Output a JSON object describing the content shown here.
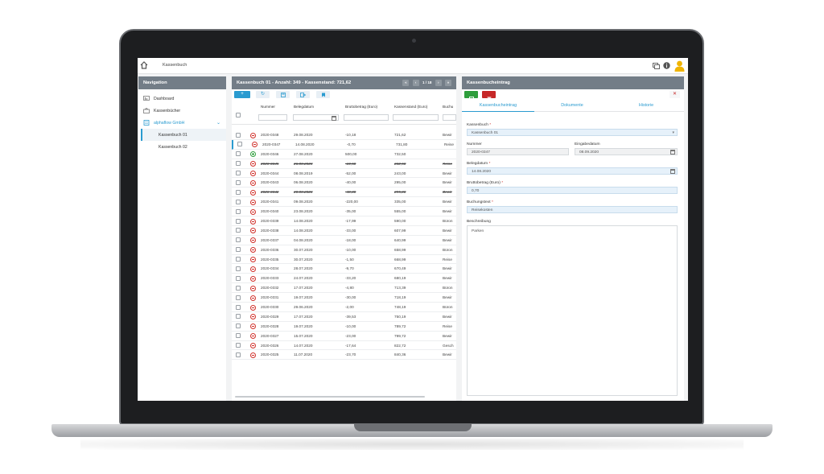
{
  "topbar": {
    "breadcrumb": "Kassenbuch"
  },
  "nav": {
    "title": "Navigation",
    "items": [
      {
        "label": "Dashboard"
      },
      {
        "label": "Kassenbücher"
      },
      {
        "label": "alphaflow GmbH"
      }
    ],
    "sub_items": [
      {
        "label": "Kassenbuch 01"
      },
      {
        "label": "Kassenbuch 02"
      }
    ]
  },
  "list": {
    "title": "Kassenbuch 01 - Anzahl: 349 - Kassenstand: 721,62",
    "pager": {
      "prev_first": "«",
      "prev": "‹",
      "page": "1 / 18",
      "next": "›",
      "next_last": "»"
    },
    "toolbar": {
      "add": "+",
      "refresh": "↻"
    },
    "columns": [
      "Nummer",
      "Belegdatum",
      "Bruttobetrag (Euro)",
      "Kassenstand (Euro)",
      "Buchu"
    ],
    "rows": [
      {
        "nummer": "2020-0348",
        "datum": "29.08.2020",
        "betrag": "-10,18",
        "stand": "721,62",
        "buchung": "Bewir",
        "status": "minus",
        "cancelled": false
      },
      {
        "nummer": "2020-0347",
        "datum": "14.08.2020",
        "betrag": "-0,70",
        "stand": "731,80",
        "buchung": "Reise",
        "status": "minus",
        "cancelled": false
      },
      {
        "nummer": "2020-0346",
        "datum": "27.08.2020",
        "betrag": "500,00",
        "stand": "732,50",
        "buchung": "",
        "status": "plus",
        "cancelled": false
      },
      {
        "nummer": "2020-0345",
        "datum": "26.08.2020",
        "betrag": "-10,50",
        "stand": "232,50",
        "buchung": "Reise",
        "status": "minus",
        "cancelled": true
      },
      {
        "nummer": "2020-0344",
        "datum": "08.08.2019",
        "betrag": "-52,00",
        "stand": "243,00",
        "buchung": "Bewir",
        "status": "minus",
        "cancelled": false
      },
      {
        "nummer": "2020-0343",
        "datum": "06.08.2020",
        "betrag": "-40,00",
        "stand": "295,00",
        "buchung": "Bewir",
        "status": "minus",
        "cancelled": false
      },
      {
        "nummer": "2020-0342",
        "datum": "20.08.2020",
        "betrag": "-40,00",
        "stand": "295,00",
        "buchung": "Bewir",
        "status": "minus",
        "cancelled": true
      },
      {
        "nummer": "2020-0341",
        "datum": "09.08.2020",
        "betrag": "-220,00",
        "stand": "335,00",
        "buchung": "Bewir",
        "status": "minus",
        "cancelled": false
      },
      {
        "nummer": "2020-0340",
        "datum": "23.08.2020",
        "betrag": "-35,00",
        "stand": "555,00",
        "buchung": "Bewir",
        "status": "minus",
        "cancelled": false
      },
      {
        "nummer": "2020-0339",
        "datum": "14.08.2020",
        "betrag": "-17,99",
        "stand": "590,00",
        "buchung": "Büron",
        "status": "minus",
        "cancelled": false
      },
      {
        "nummer": "2020-0338",
        "datum": "14.08.2020",
        "betrag": "-33,00",
        "stand": "607,99",
        "buchung": "Bewir",
        "status": "minus",
        "cancelled": false
      },
      {
        "nummer": "2020-0337",
        "datum": "04.08.2020",
        "betrag": "-18,00",
        "stand": "640,99",
        "buchung": "Bewir",
        "status": "minus",
        "cancelled": false
      },
      {
        "nummer": "2020-0336",
        "datum": "30.07.2020",
        "betrag": "-10,00",
        "stand": "658,99",
        "buchung": "Büron",
        "status": "minus",
        "cancelled": false
      },
      {
        "nummer": "2020-0335",
        "datum": "30.07.2020",
        "betrag": "-1,50",
        "stand": "668,99",
        "buchung": "Reise",
        "status": "minus",
        "cancelled": false
      },
      {
        "nummer": "2020-0334",
        "datum": "28.07.2020",
        "betrag": "-9,70",
        "stand": "670,49",
        "buchung": "Bewir",
        "status": "minus",
        "cancelled": false
      },
      {
        "nummer": "2020-0333",
        "datum": "24.07.2020",
        "betrag": "-33,20",
        "stand": "680,19",
        "buchung": "Bewir",
        "status": "minus",
        "cancelled": false
      },
      {
        "nummer": "2020-0332",
        "datum": "17.07.2020",
        "betrag": "-4,80",
        "stand": "713,39",
        "buchung": "Büron",
        "status": "minus",
        "cancelled": false
      },
      {
        "nummer": "2020-0331",
        "datum": "19.07.2020",
        "betrag": "-30,00",
        "stand": "718,19",
        "buchung": "Bewir",
        "status": "minus",
        "cancelled": false
      },
      {
        "nummer": "2020-0330",
        "datum": "29.06.2020",
        "betrag": "-2,00",
        "stand": "748,19",
        "buchung": "Büron",
        "status": "minus",
        "cancelled": false
      },
      {
        "nummer": "2020-0329",
        "datum": "17.07.2020",
        "betrag": "-39,53",
        "stand": "750,19",
        "buchung": "Bewir",
        "status": "minus",
        "cancelled": false
      },
      {
        "nummer": "2020-0328",
        "datum": "19.07.2020",
        "betrag": "-10,00",
        "stand": "789,72",
        "buchung": "Reise",
        "status": "minus",
        "cancelled": false
      },
      {
        "nummer": "2020-0327",
        "datum": "15.07.2020",
        "betrag": "-23,00",
        "stand": "799,72",
        "buchung": "Bewir",
        "status": "minus",
        "cancelled": false
      },
      {
        "nummer": "2020-0326",
        "datum": "14.07.2020",
        "betrag": "-17,64",
        "stand": "822,72",
        "buchung": "Gesch",
        "status": "minus",
        "cancelled": false
      },
      {
        "nummer": "2020-0325",
        "datum": "11.07.2020",
        "betrag": "-23,70",
        "stand": "840,36",
        "buchung": "Bewir",
        "status": "minus",
        "cancelled": false
      }
    ]
  },
  "detail": {
    "title": "Kassenbucheintrag",
    "close": "✕",
    "tabs": [
      "Kassenbucheintrag",
      "Dokumente",
      "Historie"
    ],
    "fields": {
      "kassenbuch_label": "Kassenbuch",
      "kassenbuch_value": "Kassenbuch 01",
      "nummer_label": "Nummer",
      "nummer_value": "2020-0347",
      "eingabe_label": "Eingabedatum",
      "eingabe_value": "08.09.2020",
      "belegdatum_label": "Belegdatum",
      "belegdatum_value": "14.08.2020",
      "brutto_label": "Bruttobetrag (Euro)",
      "brutto_value": "0,70",
      "buchungstext_label": "Buchungstext",
      "buchungstext_value": "Reisekosten",
      "beschreibung_label": "Beschreibung",
      "beschreibung_value": "Parken"
    },
    "required_marker": "*"
  },
  "colors": {
    "accent": "#2a9bd0",
    "header": "#737d87",
    "save": "#2e9e3c",
    "delete": "#c62828"
  }
}
